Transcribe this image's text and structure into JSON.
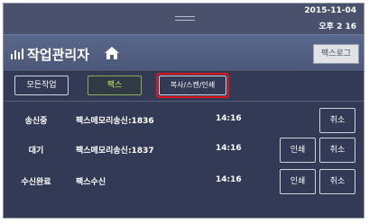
{
  "status_bar": {
    "date": "2015-11-04",
    "time": "오후 2  16"
  },
  "header": {
    "title": "작업관리자",
    "fax_log_button": "팩스로그"
  },
  "tabs": [
    "모든작업",
    "팩스",
    "복사/스캔/인쇄"
  ],
  "jobs": [
    {
      "status": "송신중",
      "name": "팩스메모리송신:1836",
      "time": "14:16",
      "cancel": "취소"
    },
    {
      "status": "대기",
      "name": "팩스메모리송신:1837",
      "time": "14:16",
      "print": "인쇄",
      "cancel": "취소"
    },
    {
      "status": "수신완료",
      "name": "팩스수신",
      "time": "14:16",
      "print": "인쇄",
      "cancel": "취소"
    }
  ],
  "colors": {
    "highlight": "#e0161c",
    "selected_tab_text": "#c9e06a"
  }
}
